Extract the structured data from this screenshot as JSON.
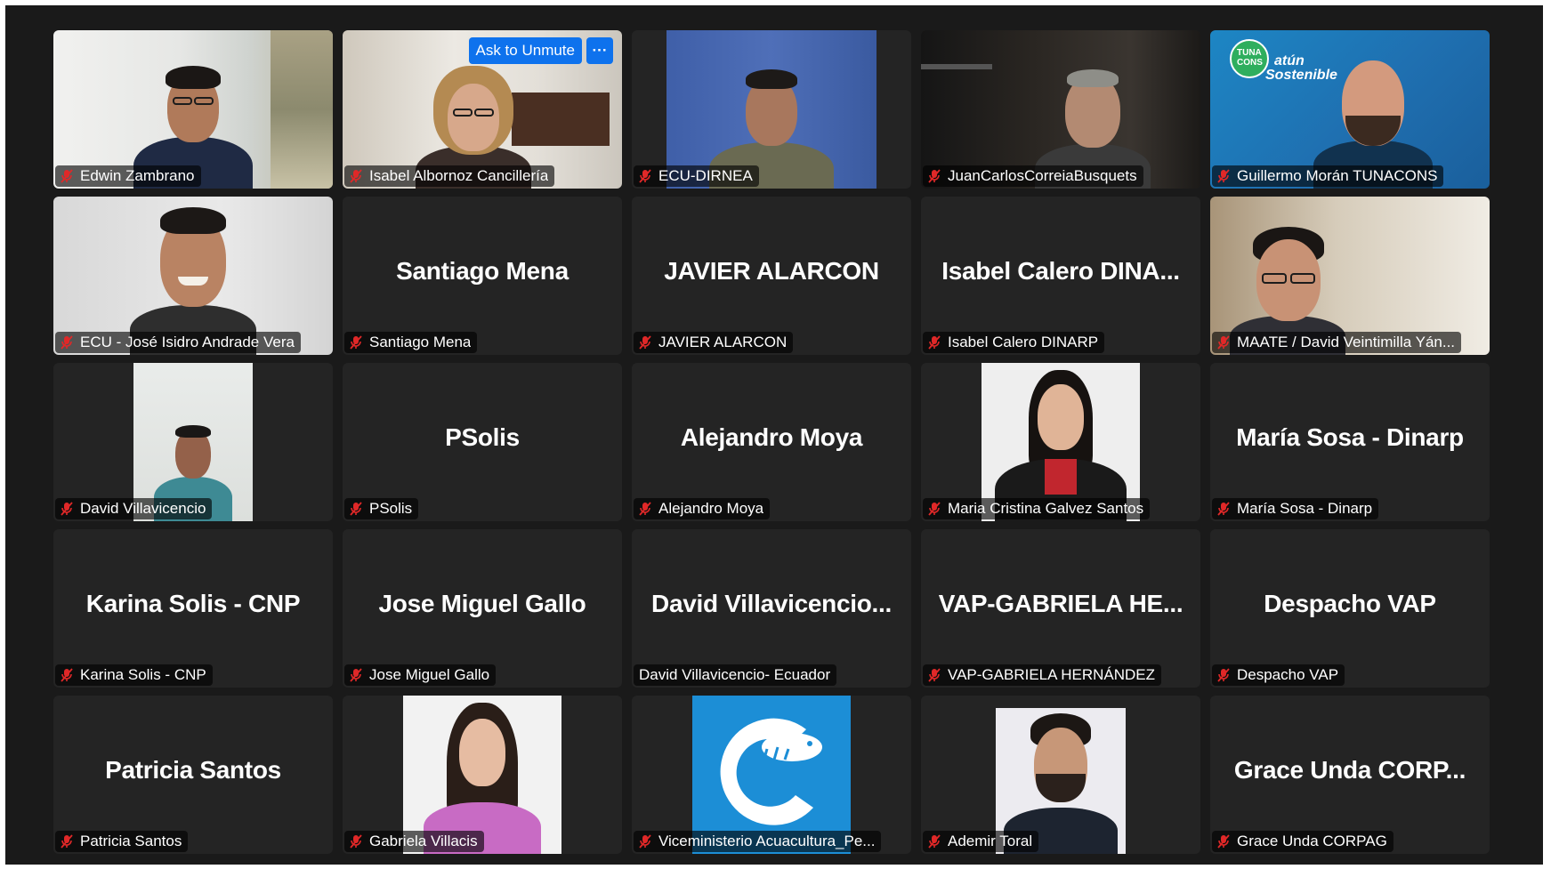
{
  "meeting": {
    "unmute_button": "Ask to Unmute",
    "more_button": "···",
    "tiles": [
      {
        "name": "Edwin Zambrano",
        "display": "",
        "muted": true
      },
      {
        "name": "Isabel Albornoz Cancillería",
        "display": "",
        "muted": true
      },
      {
        "name": "ECU-DIRNEA",
        "display": "",
        "muted": true
      },
      {
        "name": "JuanCarlosCorreiaBusquets",
        "display": "",
        "muted": true
      },
      {
        "name": "Guillermo Morán TUNACONS",
        "display": "",
        "muted": true
      },
      {
        "name": "ECU - José Isidro Andrade Vera",
        "display": "",
        "muted": true
      },
      {
        "name": "Santiago Mena",
        "display": "Santiago Mena",
        "muted": true
      },
      {
        "name": "JAVIER ALARCON",
        "display": "JAVIER ALARCON",
        "muted": true
      },
      {
        "name": "Isabel Calero DINARP",
        "display": "Isabel Calero DINA...",
        "muted": true
      },
      {
        "name": "MAATE / David Veintimilla Yán...",
        "display": "",
        "muted": true
      },
      {
        "name": "David Villavicencio",
        "display": "",
        "muted": true
      },
      {
        "name": "PSolis",
        "display": "PSolis",
        "muted": true
      },
      {
        "name": "Alejandro Moya",
        "display": "Alejandro Moya",
        "muted": true
      },
      {
        "name": "Maria Cristina Galvez Santos",
        "display": "",
        "muted": true
      },
      {
        "name": "María Sosa - Dinarp",
        "display": "María Sosa - Dinarp",
        "muted": true
      },
      {
        "name": "Karina Solis - CNP",
        "display": "Karina Solis - CNP",
        "muted": true
      },
      {
        "name": "Jose Miguel Gallo",
        "display": "Jose Miguel Gallo",
        "muted": true
      },
      {
        "name": "David Villavicencio- Ecuador",
        "display": "David Villavicencio...",
        "muted": false
      },
      {
        "name": "VAP-GABRIELA HERNÁNDEZ",
        "display": "VAP-GABRIELA HE...",
        "muted": true
      },
      {
        "name": "Despacho VAP",
        "display": "Despacho VAP",
        "muted": true
      },
      {
        "name": "Patricia Santos",
        "display": "Patricia Santos",
        "muted": true
      },
      {
        "name": "Gabriela Villacis",
        "display": "",
        "muted": true
      },
      {
        "name": "Viceministerio Acuacultura_Pe...",
        "display": "",
        "muted": true
      },
      {
        "name": "Ademir Toral",
        "display": "",
        "muted": true
      },
      {
        "name": "Grace Unda CORPAG",
        "display": "Grace Unda CORP...",
        "muted": true
      }
    ],
    "tunacons_logo": {
      "line1": "TUNA",
      "line2": "CONS",
      "line3": "atún",
      "line4": "Sostenible"
    }
  },
  "colors": {
    "background": "#1a1a1a",
    "tile": "#242424",
    "muted_icon": "#e02828",
    "unmute_button": "#0e72ed"
  }
}
